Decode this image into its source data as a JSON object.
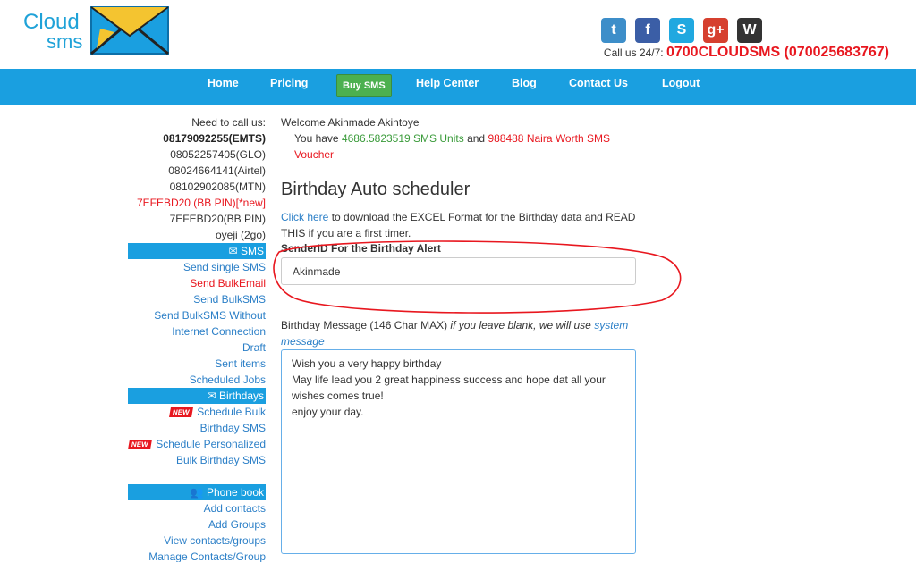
{
  "logo": {
    "line1": "Cloud",
    "line2": "sms"
  },
  "social": [
    {
      "icon": "twitter-icon",
      "glyph": "t",
      "color": "#3d8ec9"
    },
    {
      "icon": "facebook-icon",
      "glyph": "f",
      "color": "#3b5ea6"
    },
    {
      "icon": "skype-icon",
      "glyph": "S",
      "color": "#20a8e0"
    },
    {
      "icon": "google-plus-icon",
      "glyph": "g+",
      "color": "#d6402f"
    },
    {
      "icon": "wordpress-icon",
      "glyph": "W",
      "color": "#333333"
    }
  ],
  "call": {
    "prefix": "Call us 24/7:",
    "number": "0700CLOUDSMS (070025683767)"
  },
  "nav": {
    "home": "Home",
    "pricing": "Pricing",
    "buy_sms": "Buy SMS",
    "help_center": "Help Center",
    "blog": "Blog",
    "contact_us": "Contact Us",
    "logout": "Logout"
  },
  "sidebar": {
    "need_to_call": "Need to call us:",
    "phones": {
      "emts": "08179092255(EMTS)",
      "glo": "08052257405(GLO)",
      "airtel": "08024664141(Airtel)",
      "mtn": "08102902085(MTN)",
      "bbpin_new": "7EFEBD20 (BB PIN)[*new]",
      "bbpin": "7EFEBD20(BB PIN)",
      "twogo": "oyeji (2go)"
    },
    "sms_header": "SMS",
    "send_single_sms": "Send single SMS",
    "send_bulk_email": "Send BulkEmail",
    "send_bulk_sms": "Send BulkSMS",
    "send_bulk_sms_offline": "Send BulkSMS Without Internet Connection",
    "draft": "Draft",
    "sent_items": "Sent items",
    "scheduled_jobs": "Scheduled Jobs",
    "birthdays_header": "Birthdays",
    "new_badge": "NEW",
    "schedule_bulk_birthday": "Schedule Bulk Birthday SMS",
    "schedule_personalized": "Schedule Personalized Bulk Birthday SMS",
    "phonebook_header": "Phone book",
    "add_contacts": "Add contacts",
    "add_groups": "Add Groups",
    "view_contacts": "View contacts/groups",
    "manage_contacts": "Manage Contacts/Group"
  },
  "main": {
    "welcome": "Welcome Akinmade Akintoye",
    "you_have": "You have",
    "sms_units": "4686.5823519 SMS Units",
    "and": "and",
    "voucher": "988488 Naira Worth SMS Voucher",
    "title": "Birthday Auto scheduler",
    "click_here": "Click here",
    "download_text": "to download the EXCEL Format for the Birthday data and READ THIS if you are a first timer.",
    "sender_label": "SenderID For the Birthday Alert",
    "sender_value": "Akinmade",
    "message_label": "Birthday Message (146 Char MAX)",
    "message_hint": "if you leave blank, we will use",
    "system_message": "system message",
    "message_value": "Wish you a very happy birthday\nMay life lead you 2 great happiness success and hope dat all your wishes comes true!\nenjoy your day."
  }
}
